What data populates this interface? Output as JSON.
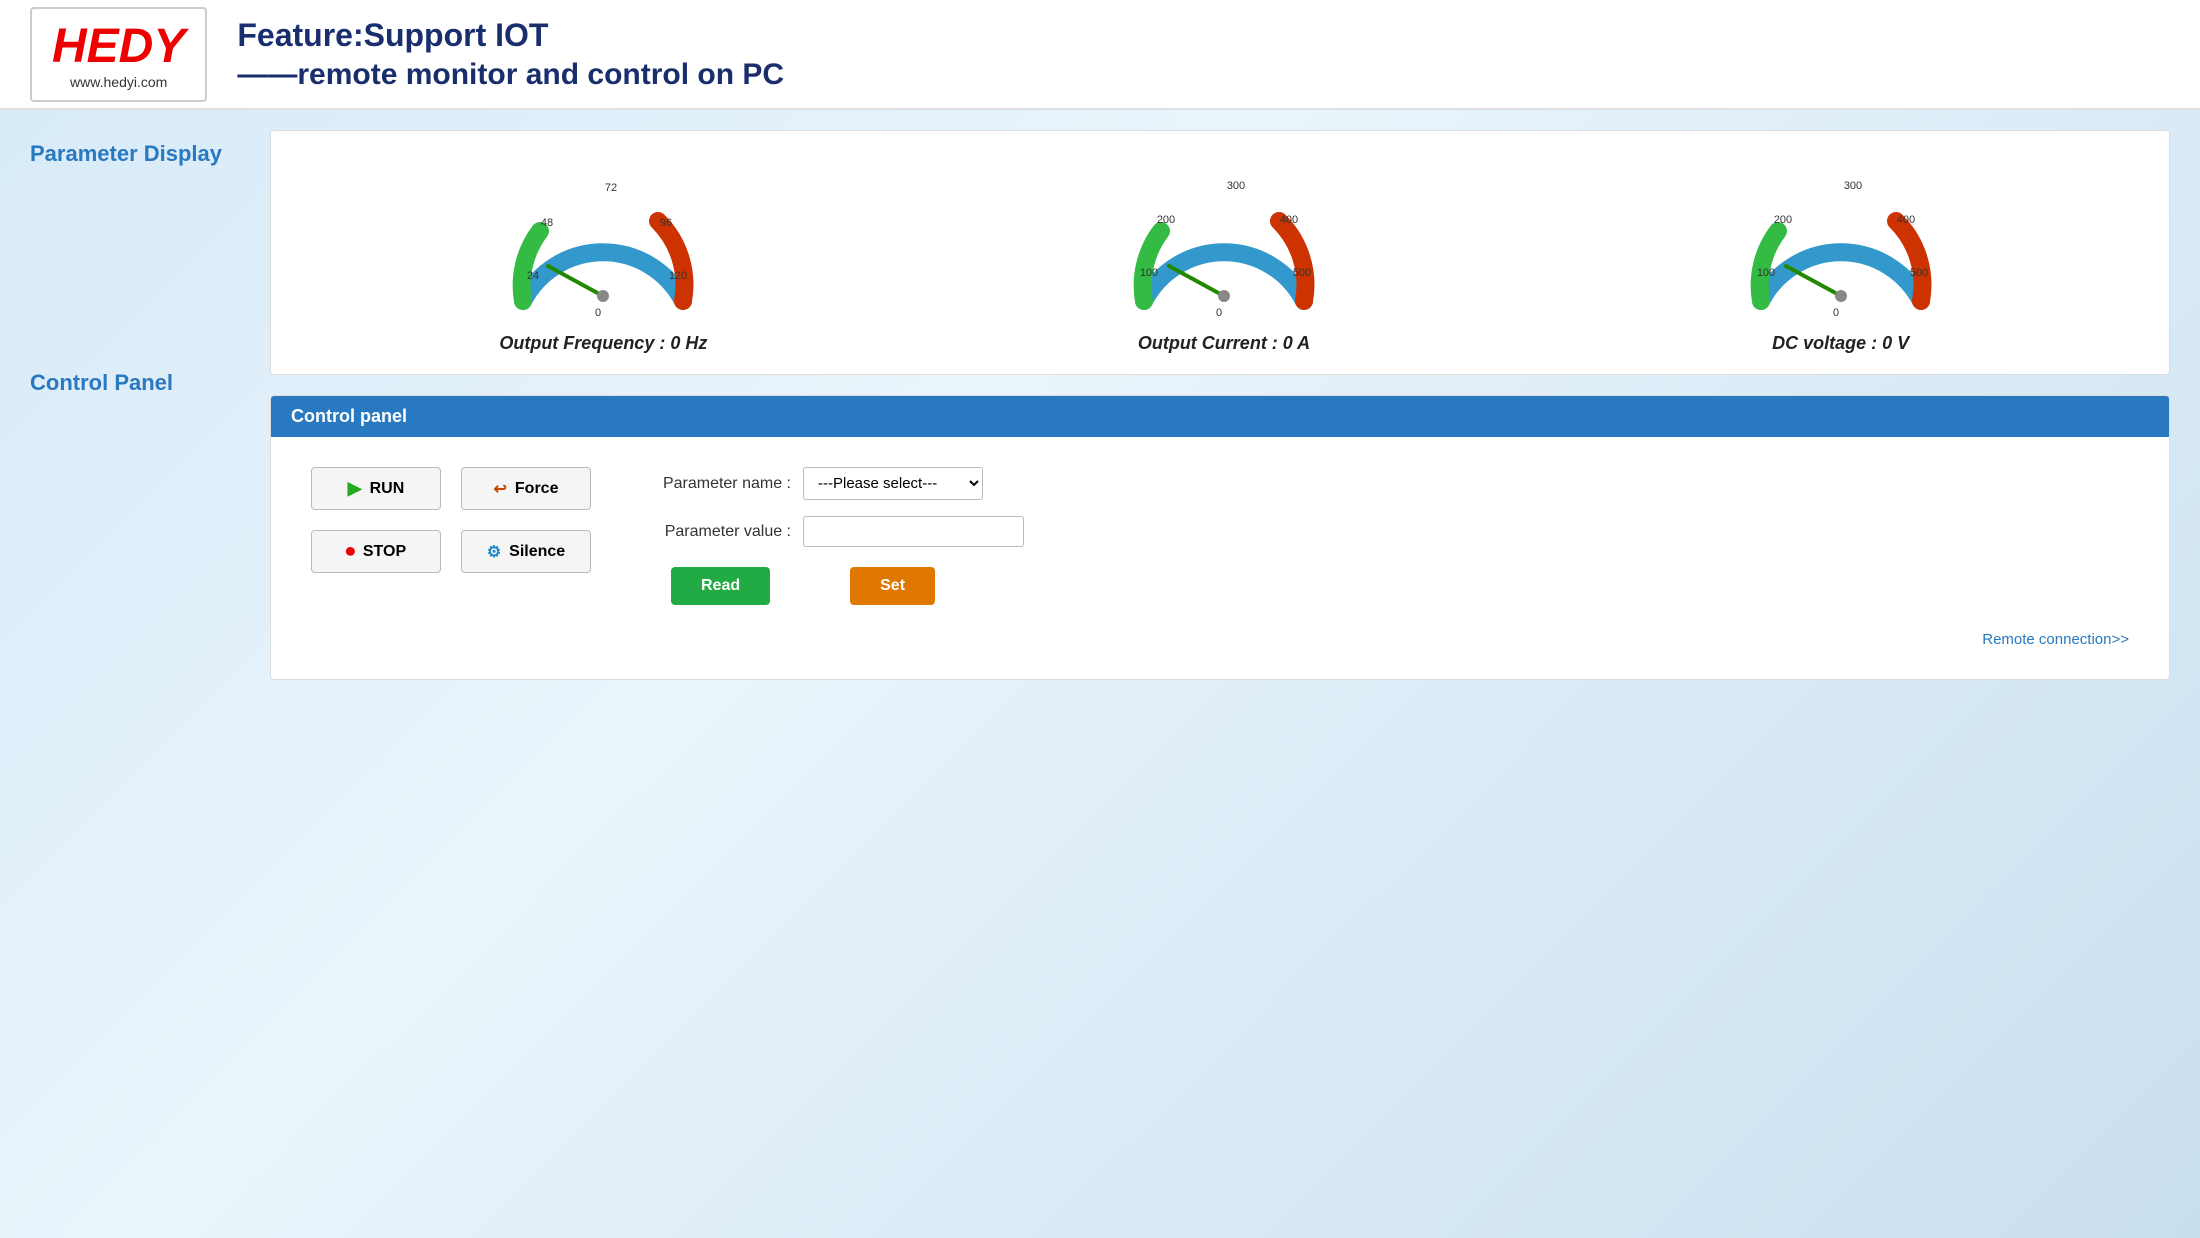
{
  "header": {
    "logo_text": "HEDY",
    "logo_url": "www.hedyi.com",
    "title_line1": "Feature:Support IOT",
    "title_line2": "——remote monitor and control on PC"
  },
  "sidebar": {
    "parameter_display_label": "Parameter Display",
    "control_panel_label": "Control Panel"
  },
  "gauges": [
    {
      "id": "freq",
      "label": "Output Frequency : 0 Hz",
      "ticks": [
        "0",
        "24",
        "48",
        "72",
        "96",
        "120"
      ],
      "needle_angle": -120,
      "value": 0
    },
    {
      "id": "current",
      "label": "Output Current : 0 A",
      "ticks": [
        "0",
        "100",
        "200",
        "300",
        "400",
        "500"
      ],
      "needle_angle": -120,
      "value": 0
    },
    {
      "id": "voltage",
      "label": "DC voltage : 0 V",
      "ticks": [
        "0",
        "100",
        "200",
        "300",
        "400",
        "500"
      ],
      "needle_angle": -120,
      "value": 0
    }
  ],
  "control_panel": {
    "header_label": "Control panel",
    "buttons": [
      {
        "id": "run",
        "label": "RUN",
        "icon": "run"
      },
      {
        "id": "force",
        "label": "Force",
        "icon": "force"
      },
      {
        "id": "stop",
        "label": "STOP",
        "icon": "stop"
      },
      {
        "id": "silence",
        "label": "Silence",
        "icon": "silence"
      }
    ],
    "parameter_name_label": "Parameter name :",
    "parameter_value_label": "Parameter value :",
    "select_placeholder": "---Please select---",
    "read_button": "Read",
    "set_button": "Set",
    "remote_connection": "Remote connection>>"
  }
}
